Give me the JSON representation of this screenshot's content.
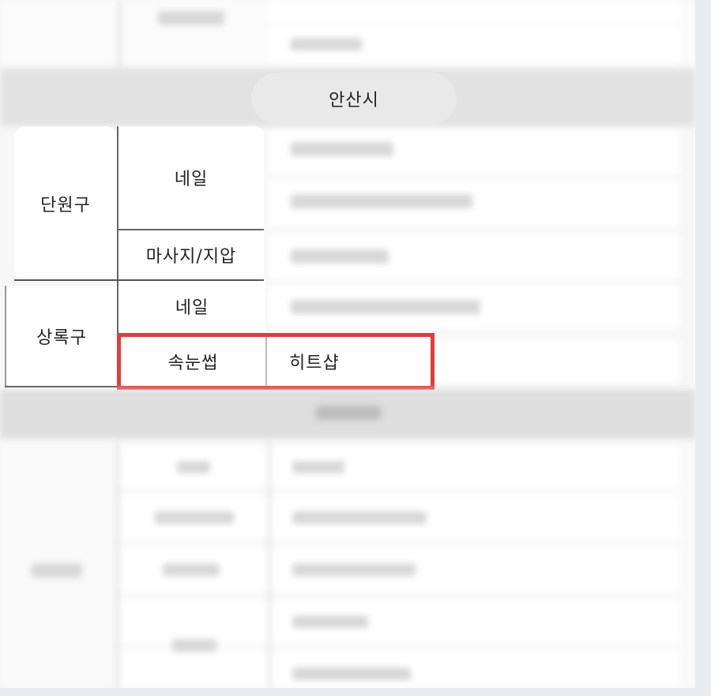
{
  "table": {
    "region_header": "안산시",
    "districts": [
      {
        "name": "단원구",
        "rows": [
          {
            "category": "네일"
          },
          {
            "category": "마사지/지압"
          }
        ]
      },
      {
        "name": "상록구",
        "rows": [
          {
            "category": "네일"
          },
          {
            "category": "속눈썹",
            "shop": "히트샵"
          }
        ]
      }
    ]
  },
  "highlight_color": "#e53b3b"
}
